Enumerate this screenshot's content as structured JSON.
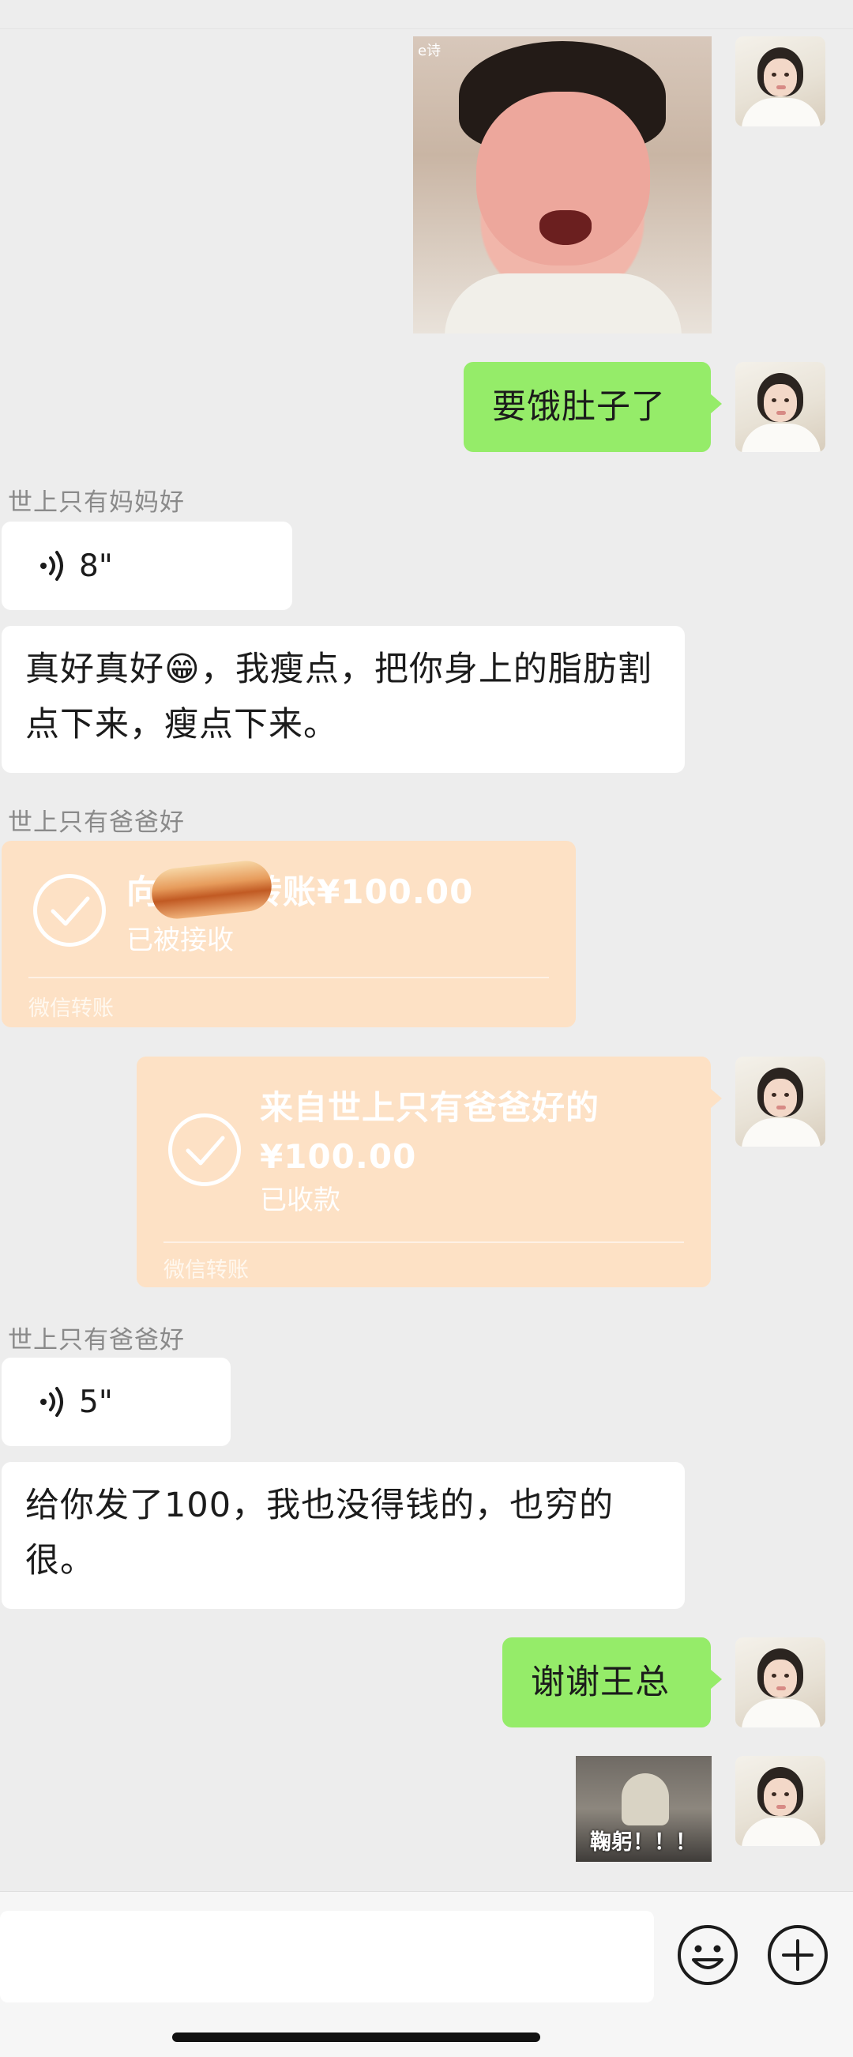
{
  "messages": {
    "m1_text": "要饿肚子了",
    "sender_mom": "世上只有妈妈好",
    "voice1_duration": "8\"",
    "m2_text": "真好真好😁，我瘦点，把你身上的脂肪割点下来，瘦点下来。",
    "sender_dad_1": "世上只有爸爸好",
    "transfer1": {
      "title_prefix": "向",
      "title_suffix": "转账¥100.00",
      "status": "已被接收",
      "footer": "微信转账"
    },
    "transfer2": {
      "title_line1": "来自世上只有爸爸好的",
      "title_line2": "¥100.00",
      "status": "已收款",
      "footer": "微信转账"
    },
    "sender_dad_2": "世上只有爸爸好",
    "voice2_duration": "5\"",
    "m3_text": "给你发了100，我也没得钱的，也穷的很。",
    "m4_text": "谢谢王总",
    "sticker_caption": "鞠躬！！！",
    "photo_tag": "e诗"
  },
  "input": {
    "placeholder": ""
  },
  "icons": {
    "voice": "voice-wave-icon",
    "emoji": "emoji-icon",
    "plus": "plus-icon",
    "check": "check-circle-icon"
  },
  "colors": {
    "background": "#ededed",
    "sent_bubble": "#95ec69",
    "received_bubble": "#ffffff",
    "transfer_card": "#fde1c5"
  }
}
